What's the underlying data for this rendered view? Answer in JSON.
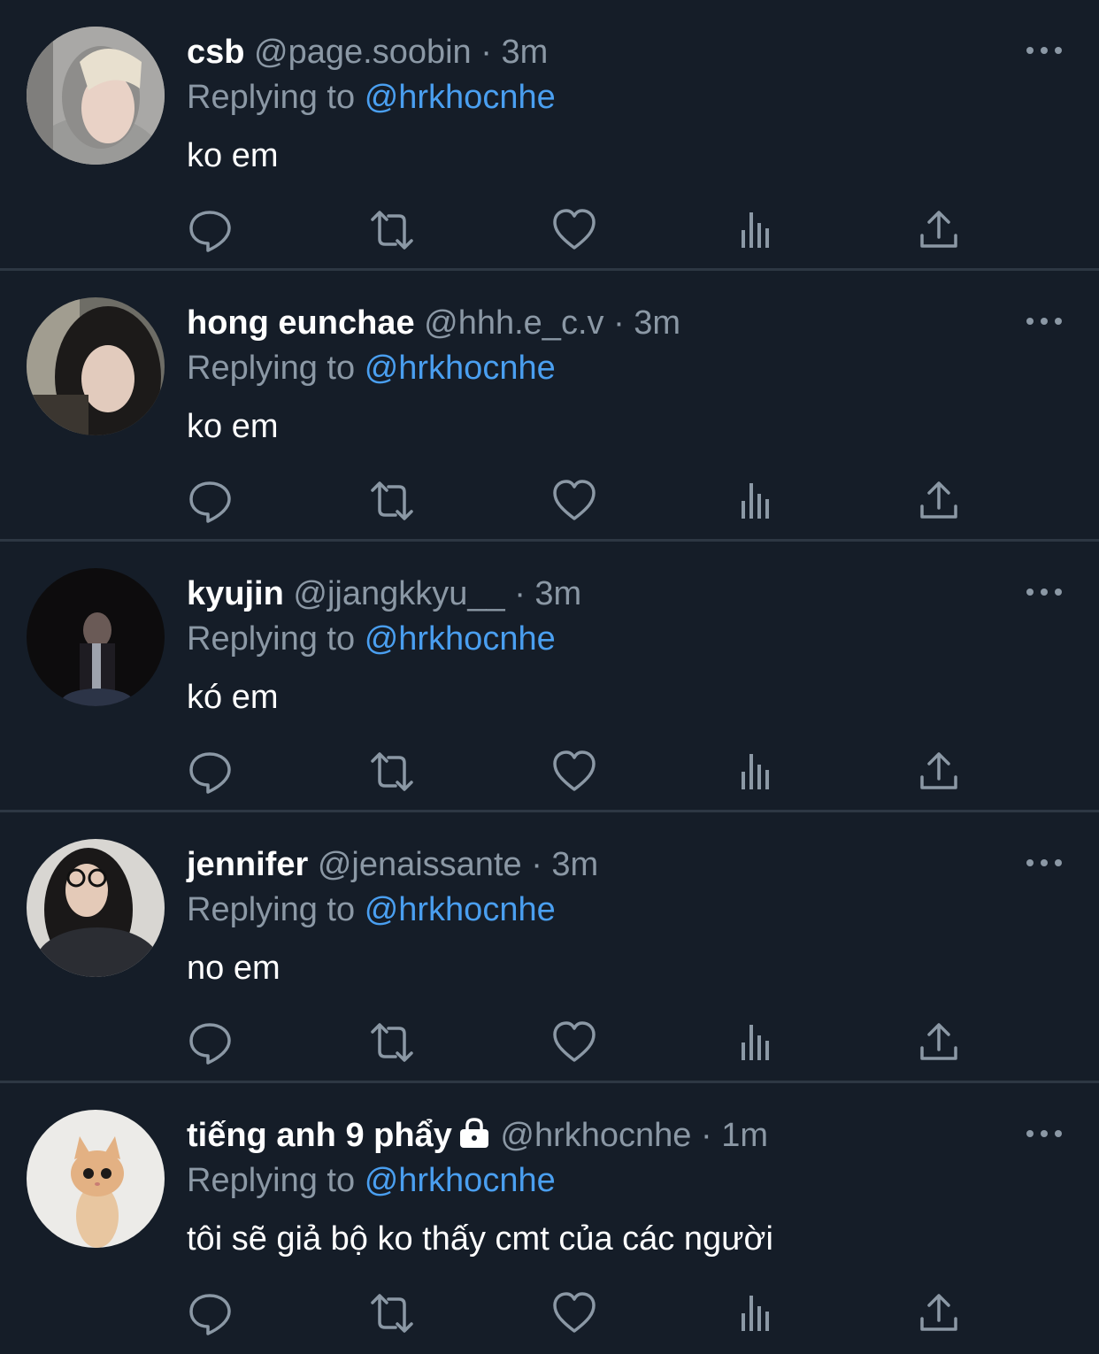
{
  "colors": {
    "background": "#151d28",
    "divider": "#2d3743",
    "secondary_text": "#8b98a5",
    "mention": "#4a9ff0",
    "primary_text": "#ffffff"
  },
  "icons": {
    "reply": "reply-icon",
    "retweet": "retweet-icon",
    "like": "heart-icon",
    "views": "views-icon",
    "share": "share-icon",
    "more": "more-icon",
    "lock": "lock-icon"
  },
  "tweets": [
    {
      "name": "csb",
      "handle": "@page.soobin",
      "separator": "·",
      "time": "3m",
      "replying_prefix": "Replying to",
      "replying_to": "@hrkhocnhe",
      "text": "ko em",
      "locked": false
    },
    {
      "name": "hong eunchae",
      "handle": "@hhh.e_c.v",
      "separator": "·",
      "time": "3m",
      "replying_prefix": "Replying to",
      "replying_to": "@hrkhocnhe",
      "text": "ko em",
      "locked": false
    },
    {
      "name": "kyujin",
      "handle": "@jjangkkyu__",
      "separator": "·",
      "time": "3m",
      "replying_prefix": "Replying to",
      "replying_to": "@hrkhocnhe",
      "text": "kó em",
      "locked": false
    },
    {
      "name": "jennifer",
      "handle": "@jenaissante",
      "separator": "·",
      "time": "3m",
      "replying_prefix": "Replying to",
      "replying_to": "@hrkhocnhe",
      "text": "no em",
      "locked": false
    },
    {
      "name": "tiếng anh 9 phẩy",
      "handle": "@hrkhocnhe",
      "separator": "·",
      "time": "1m",
      "replying_prefix": "Replying to",
      "replying_to": "@hrkhocnhe",
      "text": "tôi sẽ giả bộ ko thấy cmt của các người",
      "locked": true
    }
  ]
}
